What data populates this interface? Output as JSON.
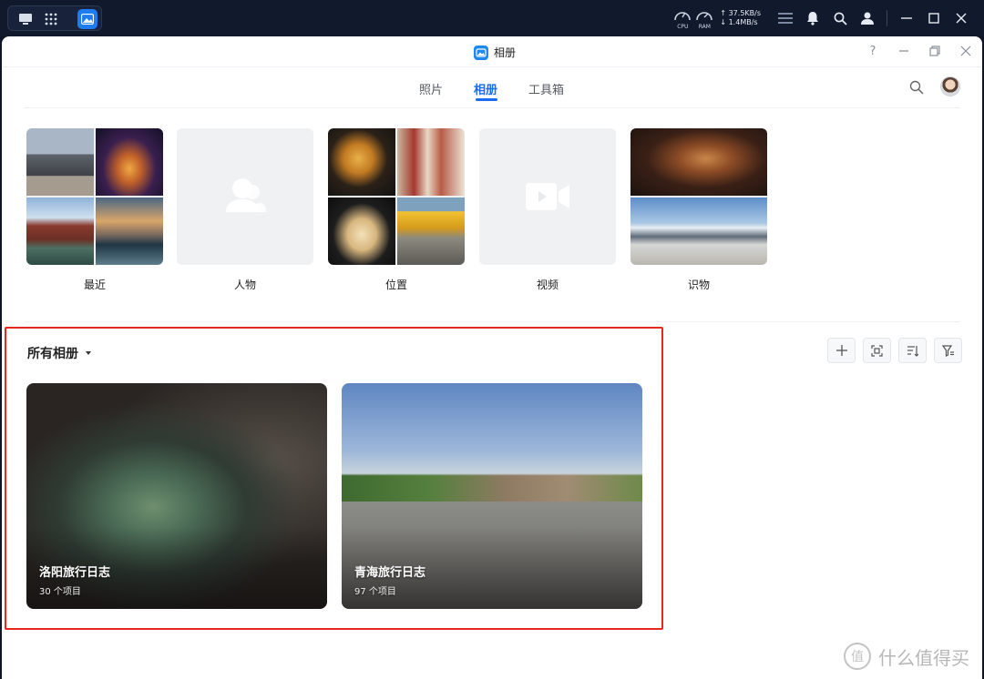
{
  "system_bar": {
    "cpu_label": "CPU",
    "ram_label": "RAM",
    "upload_speed": "↑ 37.5KB/s",
    "download_speed": "↓ 1.4MB/s"
  },
  "window": {
    "title": "相册",
    "help_label": "?"
  },
  "tabs": [
    {
      "label": "照片",
      "active": false
    },
    {
      "label": "相册",
      "active": true
    },
    {
      "label": "工具箱",
      "active": false
    }
  ],
  "categories": [
    {
      "label": "最近"
    },
    {
      "label": "人物"
    },
    {
      "label": "位置"
    },
    {
      "label": "视频"
    },
    {
      "label": "识物"
    }
  ],
  "albums_section": {
    "title": "所有相册"
  },
  "albums": [
    {
      "name": "洛阳旅行日志",
      "count": "30 个项目"
    },
    {
      "name": "青海旅行日志",
      "count": "97 个项目"
    }
  ],
  "watermark": {
    "logo_text": "值",
    "text": "什么值得买"
  },
  "colors": {
    "accent": "#1a6cf0",
    "highlight_border": "#e8281f",
    "system_bar": "#111a2c"
  }
}
